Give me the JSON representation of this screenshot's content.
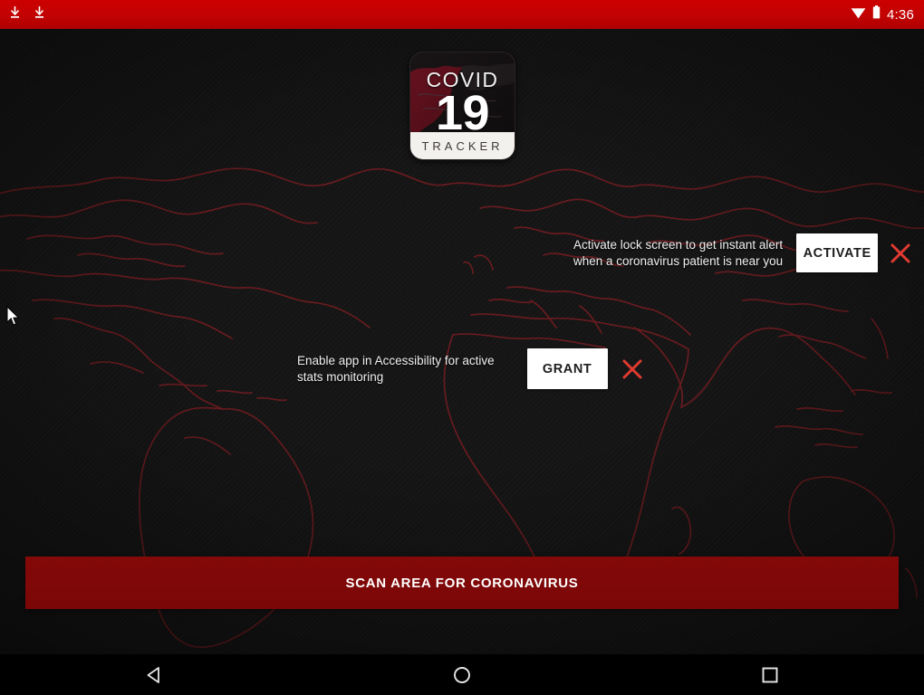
{
  "status_bar": {
    "icons_left": [
      "download-icon",
      "download-icon"
    ],
    "icons_right": [
      "wifi-icon",
      "battery-icon"
    ],
    "clock": "4:36",
    "background_color": "#c00000"
  },
  "app": {
    "logo": {
      "title_top": "COVID",
      "title_number": "19",
      "band_label": "TRACKER"
    }
  },
  "prompts": [
    {
      "id": "lockscreen",
      "message": "Activate lock screen to get instant alert\nwhen a coronavirus patient is near you",
      "button_label": "ACTIVATE",
      "dismiss_icon": "close-x-icon"
    },
    {
      "id": "accessibility",
      "message": "Enable app in Accessibility for active\nstats monitoring",
      "button_label": "GRANT",
      "dismiss_icon": "close-x-icon"
    }
  ],
  "scan": {
    "label": "SCAN AREA FOR CORONAVIRUS",
    "background_color": "#7d0808"
  },
  "nav_bar": {
    "back_icon": "back-triangle-icon",
    "home_icon": "home-circle-icon",
    "recents_icon": "recents-square-icon"
  },
  "theme": {
    "background": "#151515",
    "map_outline": "#6e1b1f",
    "accent_red": "#e03a30",
    "status_red": "#c00000",
    "scan_red": "#7d0808"
  }
}
